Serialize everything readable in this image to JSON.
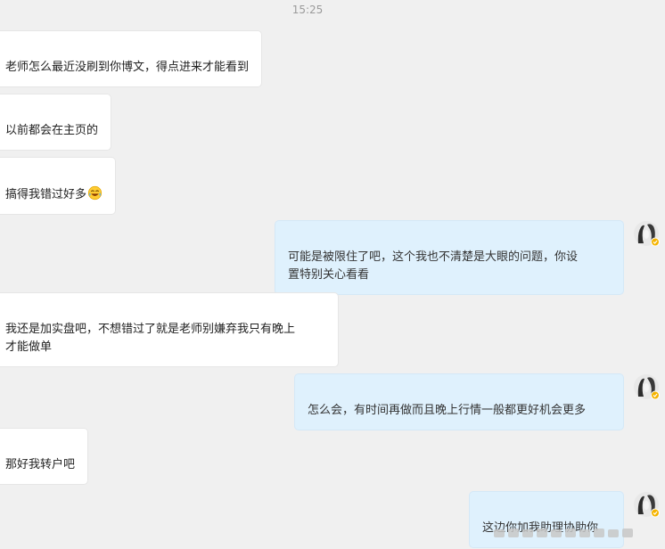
{
  "chat": {
    "timestamp": "15:25",
    "messages": [
      {
        "direction": "incoming",
        "text": "老师怎么最近没刷到你博文，得点进来才能看到"
      },
      {
        "direction": "incoming",
        "text": "以前都会在主页的"
      },
      {
        "direction": "incoming",
        "text": "搞得我错过好多",
        "emoji": "laughing-tears-emoji"
      },
      {
        "direction": "outgoing",
        "text": "可能是被限住了吧，这个我也不清楚是大眼的问题，你设\n置特别关心看看"
      },
      {
        "direction": "incoming",
        "text": "我还是加实盘吧，不想错过了就是老师别嫌弃我只有晚上\n才能做单"
      },
      {
        "direction": "outgoing",
        "text": "怎么会，有时间再做而且晚上行情一般都更好机会更多"
      },
      {
        "direction": "incoming",
        "text": "那好我转户吧"
      },
      {
        "direction": "outgoing",
        "text": "这边你加我助理协助你"
      }
    ]
  },
  "icons": {
    "avatar": "user-avatar-icon",
    "verified_badge": "verified-badge-icon",
    "watermark": "blurred-watermark"
  },
  "colors": {
    "background": "#f0f0f0",
    "incoming_bubble": "#ffffff",
    "outgoing_bubble": "#dff1fd",
    "timestamp": "#9a9a9a",
    "badge": "#f5b400"
  }
}
